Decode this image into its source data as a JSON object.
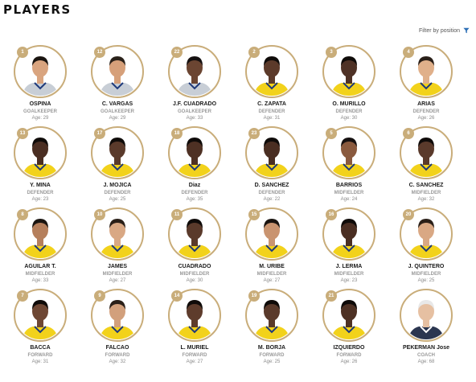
{
  "page": {
    "title": "PLAYERS",
    "filter_label": "Filter by position",
    "age_prefix": "Age: "
  },
  "colors": {
    "ring": "#c9ad7a",
    "jersey_yellow": "#f2d21b",
    "jersey_gk": "#8a94a3"
  },
  "players": [
    {
      "number": "1",
      "name": "OSPINA",
      "position": "GOALKEEPER",
      "age": "29",
      "skin": "#d9a47f",
      "hair": "#1a1410",
      "jersey": "#c8ced6"
    },
    {
      "number": "12",
      "name": "C. VARGAS",
      "position": "GOALKEEPER",
      "age": "29",
      "skin": "#d6a07a",
      "hair": "#2a211a",
      "jersey": "#c8ced6"
    },
    {
      "number": "22",
      "name": "J.F. CUADRADO",
      "position": "GOALKEEPER",
      "age": "33",
      "skin": "#6b4532",
      "hair": "#151010",
      "jersey": "#c8ced6"
    },
    {
      "number": "2",
      "name": "C. ZAPATA",
      "position": "DEFENDER",
      "age": "31",
      "skin": "#5c3a2a",
      "hair": "#0f0b09",
      "jersey": "#f2d21b"
    },
    {
      "number": "3",
      "name": "O. MURILLO",
      "position": "DEFENDER",
      "age": "30",
      "skin": "#4f3226",
      "hair": "#0f0b09",
      "jersey": "#f2d21b"
    },
    {
      "number": "4",
      "name": "ARIAS",
      "position": "DEFENDER",
      "age": "26",
      "skin": "#e0b08a",
      "hair": "#2a1f18",
      "jersey": "#f2d21b"
    },
    {
      "number": "13",
      "name": "Y. MINA",
      "position": "DEFENDER",
      "age": "23",
      "skin": "#4a2e22",
      "hair": "#0f0b09",
      "jersey": "#f2d21b"
    },
    {
      "number": "17",
      "name": "J. MOJICA",
      "position": "DEFENDER",
      "age": "25",
      "skin": "#5a3a2b",
      "hair": "#0f0b09",
      "jersey": "#f2d21b"
    },
    {
      "number": "18",
      "name": "Diaz",
      "position": "DEFENDER",
      "age": "35",
      "skin": "#4e3124",
      "hair": "#0f0b09",
      "jersey": "#f2d21b"
    },
    {
      "number": "23",
      "name": "D. SANCHEZ",
      "position": "DEFENDER",
      "age": "22",
      "skin": "#4a2e22",
      "hair": "#0f0b09",
      "jersey": "#f2d21b"
    },
    {
      "number": "5",
      "name": "BARRIOS",
      "position": "MIDFIELDER",
      "age": "24",
      "skin": "#8a5a3e",
      "hair": "#151010",
      "jersey": "#f2d21b"
    },
    {
      "number": "6",
      "name": "C. SANCHEZ",
      "position": "MIDFIELDER",
      "age": "32",
      "skin": "#5a3a2b",
      "hair": "#0f0b09",
      "jersey": "#f2d21b"
    },
    {
      "number": "8",
      "name": "AGUILAR T.",
      "position": "MIDFIELDER",
      "age": "33",
      "skin": "#b57f5c",
      "hair": "#1a1410",
      "jersey": "#f2d21b"
    },
    {
      "number": "10",
      "name": "JAMES",
      "position": "MIDFIELDER",
      "age": "27",
      "skin": "#d9a884",
      "hair": "#2a1f18",
      "jersey": "#f2d21b"
    },
    {
      "number": "11",
      "name": "CUADRADO",
      "position": "MIDFIELDER",
      "age": "30",
      "skin": "#5a3a2b",
      "hair": "#0f0b09",
      "jersey": "#f2d21b"
    },
    {
      "number": "15",
      "name": "M. URIBE",
      "position": "MIDFIELDER",
      "age": "27",
      "skin": "#c99470",
      "hair": "#1a1410",
      "jersey": "#f2d21b"
    },
    {
      "number": "16",
      "name": "J. LERMA",
      "position": "MIDFIELDER",
      "age": "23",
      "skin": "#4a2e22",
      "hair": "#0f0b09",
      "jersey": "#f2d21b"
    },
    {
      "number": "20",
      "name": "J. QUINTERO",
      "position": "MIDFIELDER",
      "age": "25",
      "skin": "#d9a884",
      "hair": "#2a1f18",
      "jersey": "#f2d21b"
    },
    {
      "number": "7",
      "name": "BACCA",
      "position": "FORWARD",
      "age": "31",
      "skin": "#6e4734",
      "hair": "#0f0b09",
      "jersey": "#f2d21b"
    },
    {
      "number": "9",
      "name": "FALCAO",
      "position": "FORWARD",
      "age": "32",
      "skin": "#d2a07c",
      "hair": "#2a1f18",
      "jersey": "#f2d21b"
    },
    {
      "number": "14",
      "name": "L. MURIEL",
      "position": "FORWARD",
      "age": "27",
      "skin": "#5e3c2c",
      "hair": "#0f0b09",
      "jersey": "#f2d21b"
    },
    {
      "number": "19",
      "name": "M. BORJA",
      "position": "FORWARD",
      "age": "25",
      "skin": "#5a3a2b",
      "hair": "#0f0b09",
      "jersey": "#f2d21b"
    },
    {
      "number": "21",
      "name": "IZQUIERDO",
      "position": "FORWARD",
      "age": "26",
      "skin": "#4e3124",
      "hair": "#0f0b09",
      "jersey": "#f2d21b"
    },
    {
      "number": "",
      "name": "PEKERMAN Jose",
      "position": "COACH",
      "age": "68",
      "skin": "#e6c0a2",
      "hair": "#e8e8e8",
      "jersey": "#2b3650"
    }
  ]
}
